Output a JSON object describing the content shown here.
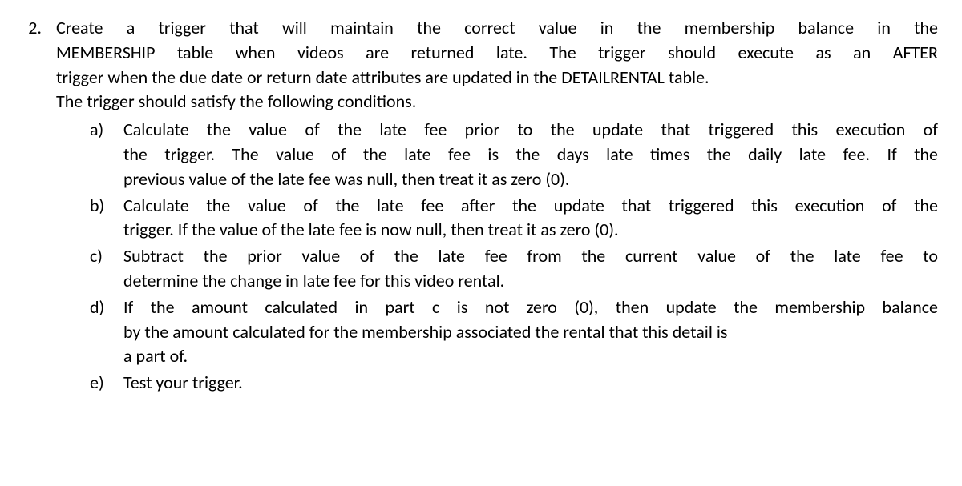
{
  "question": {
    "number": "2.",
    "intro_line1": "Create a trigger that will maintain the correct value in the membership balance in the",
    "intro_line2": "MEMBERSHIP table when videos are returned late. The trigger should execute as an AFTER",
    "intro_line3": "trigger when the due date or return date attributes are updated in the DETAILRENTAL table.",
    "intro_line4": "The trigger should satisfy the following conditions.",
    "items": {
      "a": {
        "letter": "a)",
        "line1": "Calculate the value of the late fee prior to the update that triggered this execution of",
        "line2": "the trigger. The value of the late fee is the days late times the daily late fee. If the",
        "line3": "previous value of the late fee was null, then treat it as zero (0)."
      },
      "b": {
        "letter": "b)",
        "line1": "Calculate the value of the late fee after the update that triggered this execution of the",
        "line2": "trigger. If the value of the late fee is now null, then treat it as zero (0)."
      },
      "c": {
        "letter": "c)",
        "line1": "Subtract the prior value of the late fee from the current value of the late fee to",
        "line2": "determine the change in late fee for this video rental."
      },
      "d": {
        "letter": "d)",
        "line1": "If the amount calculated in part c is not zero (0), then update the membership balance",
        "line2": "by the amount calculated for the membership associated the rental that this detail is",
        "line3": "a part of."
      },
      "e": {
        "letter": "e)",
        "text": "Test your trigger."
      }
    }
  }
}
